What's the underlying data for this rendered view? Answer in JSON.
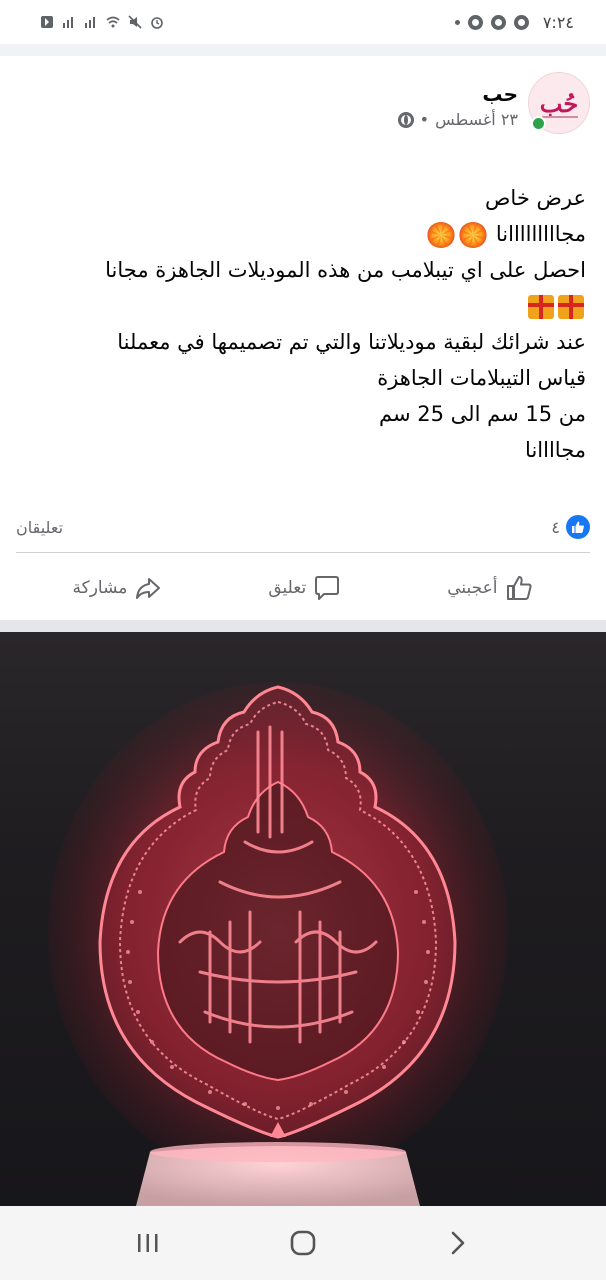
{
  "status_bar": {
    "time": "٧:٢٤"
  },
  "post": {
    "page_name": "حب",
    "date": "٢٣ أغسطس",
    "separator": "•",
    "lines": [
      "عرض خاص",
      "مجااااااااانا",
      "احصل على اي تيبلامب من هذه الموديلات الجاهزة مجانا",
      "",
      "عند شرائك لبقية موديلاتنا والتي تم تصميمها في معملنا",
      "قياس التيبلامات الجاهزة",
      "من 15 سم الى 25 سم",
      "مجاااانا"
    ],
    "avatar_mark": "حُب"
  },
  "reactions": {
    "likes_count": "٤",
    "comments_label": "تعليقان"
  },
  "actions": {
    "like_label": "أعجبني",
    "comment_label": "تعليق",
    "share_label": "مشاركة"
  },
  "colors": {
    "facebook_blue": "#1877f2",
    "secondary_text": "#65676b",
    "online_green": "#31a24c",
    "lamp_glow": "#ff3b4f"
  }
}
